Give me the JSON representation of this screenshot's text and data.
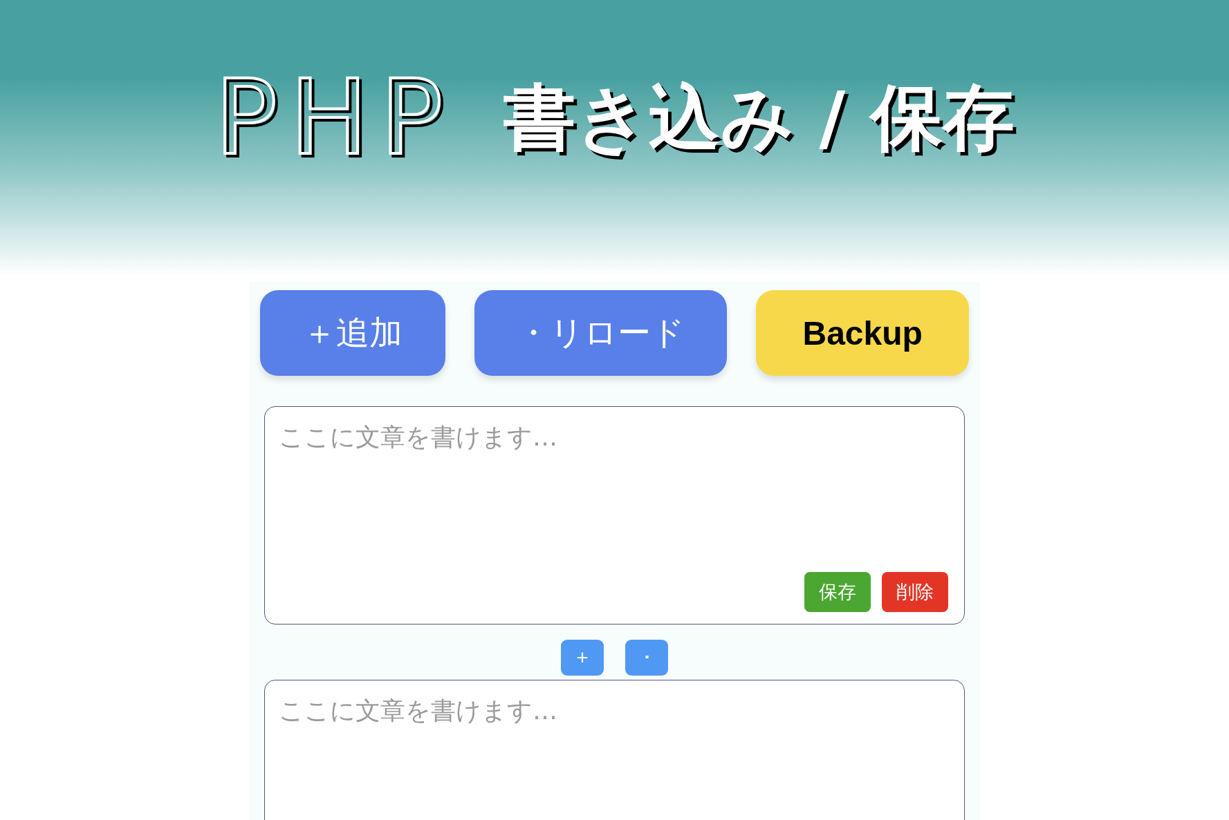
{
  "header": {
    "logo": "PHP",
    "title": "書き込み / 保存"
  },
  "toolbar": [
    {
      "kind": "primary",
      "label": "＋追加"
    },
    {
      "kind": "primary",
      "label": "・リロード"
    },
    {
      "kind": "backup",
      "label": "Backup"
    }
  ],
  "notes": [
    {
      "placeholder": "ここに文章を書けます…",
      "actions": [
        {
          "kind": "save",
          "label": "保存"
        },
        {
          "kind": "delete",
          "label": "削除"
        }
      ],
      "insert_controls": [
        "+",
        "･"
      ]
    },
    {
      "placeholder": "ここに文章を書けます…"
    }
  ]
}
